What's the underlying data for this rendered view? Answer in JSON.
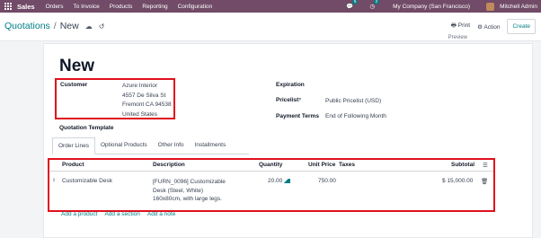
{
  "navbar": {
    "app_name": "Sales",
    "menu": [
      "Orders",
      "To Invoice",
      "Products",
      "Reporting",
      "Configuration"
    ],
    "messages_count": "5",
    "activities_count": "2",
    "company": "My Company (San Francisco)",
    "user": "Mitchell Admin"
  },
  "control_panel": {
    "breadcrumb_parent": "Quotations",
    "breadcrumb_separator": "/",
    "breadcrumb_current": "New",
    "print_label": "Print",
    "action_label": "Action",
    "create_label": "Create"
  },
  "form": {
    "preview_label": "Preview",
    "title": "New",
    "customer": {
      "label": "Customer",
      "address_lines": [
        "Azure Interior",
        "4557 De Silva St",
        "Fremont CA 94538",
        "United States"
      ]
    },
    "expiration_label": "Expiration",
    "pricelist_label": "Pricelist",
    "pricelist_help": "?",
    "pricelist_value": "Public Pricelist (USD)",
    "payment_terms_label": "Payment Terms",
    "payment_terms_value": "End of Following Month",
    "quotation_template_label": "Quotation Template",
    "tabs": [
      "Order Lines",
      "Optional Products",
      "Other Info",
      "Installments"
    ],
    "active_tab": "Order Lines"
  },
  "order_lines": {
    "columns": {
      "product": "Product",
      "description": "Description",
      "quantity": "Quantity",
      "unit_price": "Unit Price",
      "taxes": "Taxes",
      "subtotal": "Subtotal"
    },
    "rows": [
      {
        "product": "Customizable Desk",
        "description_lines": [
          "[FURN_0096] Customizable",
          "Desk (Steel, White)",
          "160x80cm, with large legs."
        ],
        "quantity": "20.00",
        "unit_price": "750.00",
        "taxes": "",
        "subtotal": "$ 15,000.00"
      }
    ],
    "add_product": "Add a product",
    "add_section": "Add a section",
    "add_note": "Add a note"
  },
  "icons": {
    "apps": "grid-icon",
    "messages": "chat-icon",
    "activities": "clock-icon",
    "save": "cloud-upload-icon",
    "discard": "undo-icon",
    "print": "printer-icon",
    "action": "gear-icon",
    "drag": "drag-handle-icon",
    "forecast": "area-chart-icon",
    "delete": "trash-icon",
    "optional_columns": "sliders-icon"
  },
  "colors": {
    "navbar_bg": "#714b67",
    "link": "#017e84",
    "highlight_border": "#e0101c"
  }
}
